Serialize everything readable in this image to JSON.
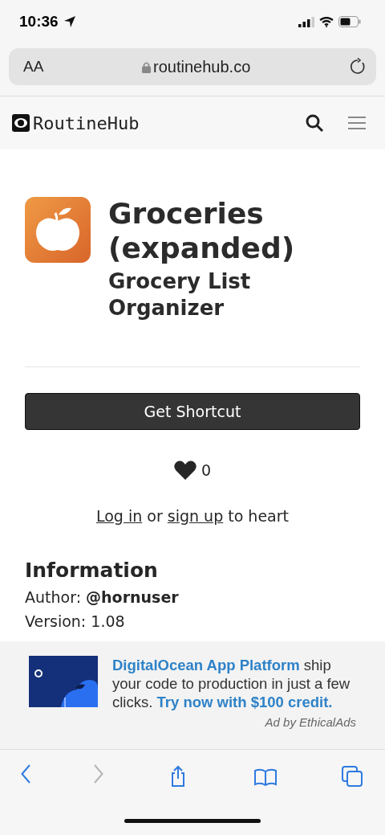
{
  "status_bar": {
    "time": "10:36"
  },
  "address_bar": {
    "text_size": "AA",
    "url": "routinehub.co"
  },
  "site_nav": {
    "brand": "RoutineHub"
  },
  "shortcut": {
    "title": "Groceries (expanded)",
    "subtitle": "Grocery List Organizer",
    "get_button": "Get Shortcut",
    "hearts": "0"
  },
  "heart_prompt": {
    "login": "Log in",
    "middle": " or ",
    "signup": "sign up",
    "end": " to heart"
  },
  "information": {
    "heading": "Information",
    "lines": [
      "Author: **@hornuser**",
      "Version: 1.08"
    ]
  },
  "ad": {
    "headline": "DigitalOcean App Platform",
    "body": " ship your code to production in just a few clicks. ",
    "cta": "Try now with $100 credit.",
    "credit": "Ad by EthicalAds"
  },
  "toolbar": [
    {
      "kind": "back",
      "disabled": false
    },
    {
      "kind": "forward",
      "disabled": true
    },
    {
      "kind": "share",
      "disabled": false
    },
    {
      "kind": "bookmarks",
      "disabled": false
    },
    {
      "kind": "tabs",
      "disabled": false
    }
  ]
}
